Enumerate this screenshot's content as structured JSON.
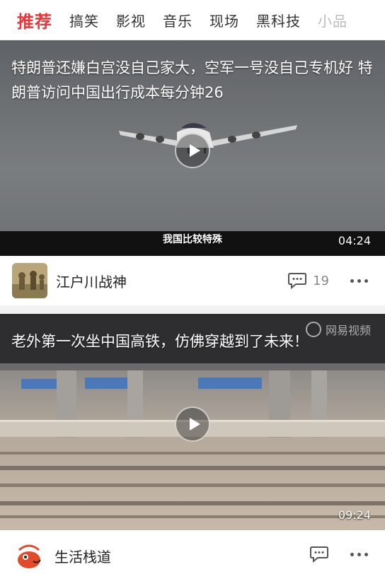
{
  "tabs": [
    "推荐",
    "搞笑",
    "影视",
    "音乐",
    "现场",
    "黑科技",
    "小品"
  ],
  "active_tab": "推荐",
  "feed": [
    {
      "title": "特朗普还嫌白宫没自己家大，空军一号没自己专机好 特朗普访问中国出行成本每分钟26",
      "subtitle": "我国比较特殊",
      "duration": "04:24",
      "watermark": "",
      "author": "江户川战神",
      "comments": "19"
    },
    {
      "title": "老外第一次坐中国高铁，仿佛穿越到了未来！",
      "subtitle": "",
      "duration": "09:24",
      "watermark": "网易视频",
      "author": "生活栈道",
      "comments": ""
    }
  ],
  "colors": {
    "accent": "#e8363a"
  },
  "icons": [
    "play-icon",
    "comment-icon",
    "more-icon"
  ]
}
